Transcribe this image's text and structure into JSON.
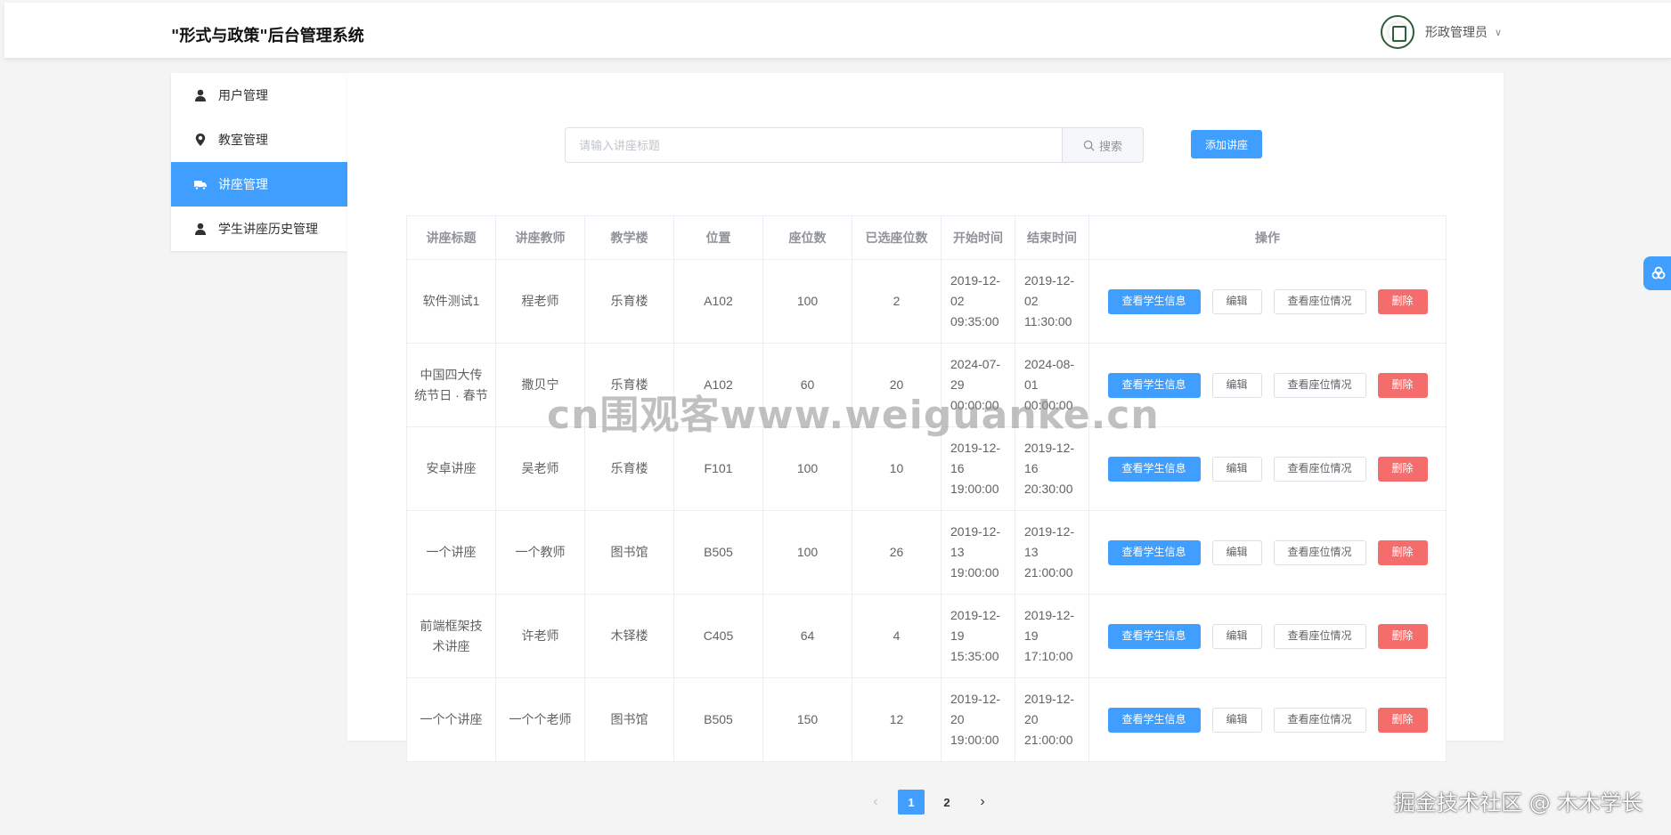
{
  "header": {
    "title": "\"形式与政策\"后台管理系统",
    "user_name": "形政管理员",
    "caret": "∨"
  },
  "sidebar": {
    "items": [
      {
        "label": "用户管理",
        "icon": "user-icon"
      },
      {
        "label": "教室管理",
        "icon": "location-icon"
      },
      {
        "label": "讲座管理",
        "icon": "truck-icon",
        "active": true
      },
      {
        "label": "学生讲座历史管理",
        "icon": "user-icon"
      }
    ]
  },
  "search": {
    "placeholder": "请输入讲座标题",
    "button_label": "搜索"
  },
  "add_button": "添加讲座",
  "table": {
    "columns": [
      "讲座标题",
      "讲座教师",
      "教学楼",
      "位置",
      "座位数",
      "已选座位数",
      "开始时间",
      "结束时间",
      "操作"
    ],
    "rows": [
      {
        "title": "软件测试1",
        "teacher": "程老师",
        "building": "乐育楼",
        "location": "A102",
        "seats": "100",
        "selected": "2",
        "start": "2019-12-02 09:35:00",
        "end": "2019-12-02 11:30:00"
      },
      {
        "title": "中国四大传统节日 · 春节",
        "teacher": "撒贝宁",
        "building": "乐育楼",
        "location": "A102",
        "seats": "60",
        "selected": "20",
        "start": "2024-07-29 00:00:00",
        "end": "2024-08-01 00:00:00"
      },
      {
        "title": "安卓讲座",
        "teacher": "吴老师",
        "building": "乐育楼",
        "location": "F101",
        "seats": "100",
        "selected": "10",
        "start": "2019-12-16 19:00:00",
        "end": "2019-12-16 20:30:00"
      },
      {
        "title": "一个讲座",
        "teacher": "一个教师",
        "building": "图书馆",
        "location": "B505",
        "seats": "100",
        "selected": "26",
        "start": "2019-12-13 19:00:00",
        "end": "2019-12-13 21:00:00"
      },
      {
        "title": "前端框架技术讲座",
        "teacher": "许老师",
        "building": "木铎楼",
        "location": "C405",
        "seats": "64",
        "selected": "4",
        "start": "2019-12-19 15:35:00",
        "end": "2019-12-19 17:10:00"
      },
      {
        "title": "一个个讲座",
        "teacher": "一个个老师",
        "building": "图书馆",
        "location": "B505",
        "seats": "150",
        "selected": "12",
        "start": "2019-12-20 19:00:00",
        "end": "2019-12-20 21:00:00"
      }
    ],
    "actions": {
      "view_students": "查看学生信息",
      "edit": "编辑",
      "view_seats": "查看座位情况",
      "delete": "删除"
    }
  },
  "pagination": {
    "prev": "‹",
    "next": "›",
    "pages": [
      "1",
      "2"
    ],
    "current": "1"
  },
  "watermark": "cn围观客www.weiguanke.cn",
  "footer_mark": "掘金技术社区 @ 木木学长",
  "colors": {
    "primary": "#409eff",
    "danger": "#f56c6c"
  }
}
